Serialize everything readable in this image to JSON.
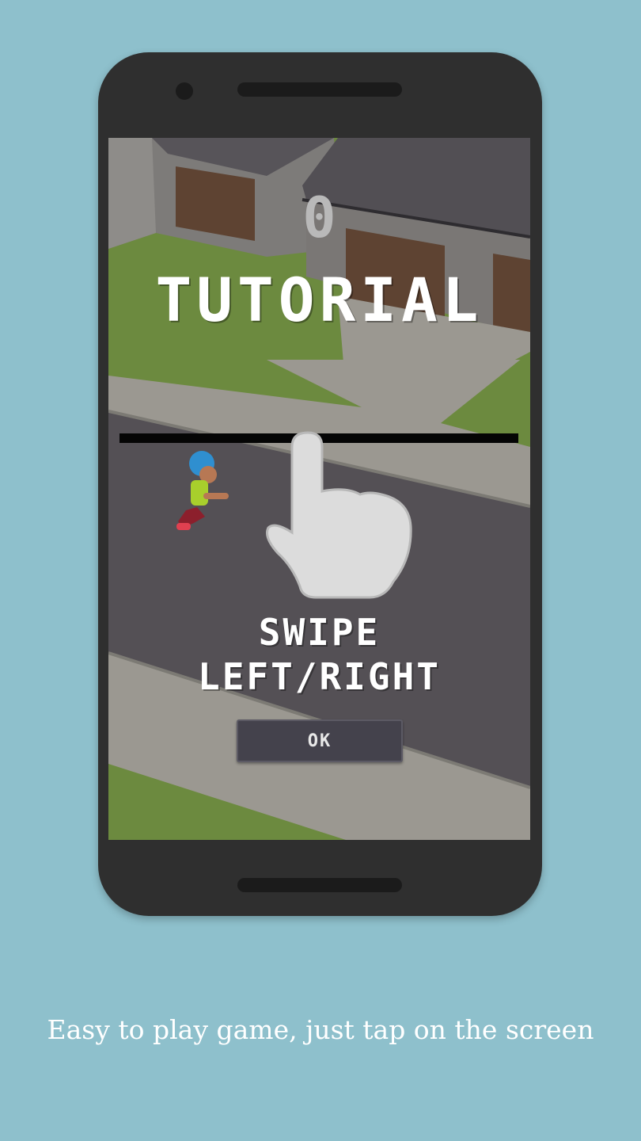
{
  "game": {
    "score": "0",
    "title": "TUTORIAL",
    "instruction_line1": "SWIPE",
    "instruction_line2": "LEFT/RIGHT",
    "ok_label": "OK"
  },
  "caption": "Easy to play game, just tap on the screen",
  "colors": {
    "background": "#8ec0cc",
    "phone_body": "#2f2f2f",
    "grass": "#6c8a3f",
    "road": "#545055",
    "sidewalk": "#a09d95",
    "button": "#44424c"
  },
  "icons": {
    "hand": "tap-hand-icon",
    "character": "runner-character"
  }
}
